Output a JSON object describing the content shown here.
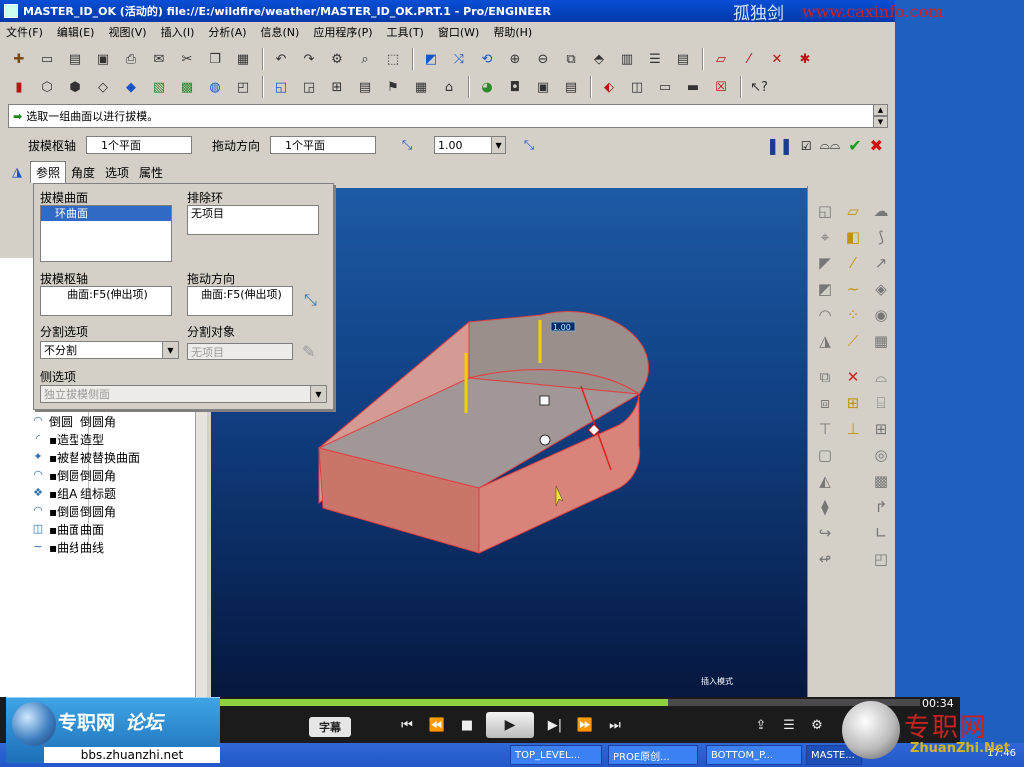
{
  "window": {
    "title": "MASTER_ID_OK (活动的) file://E:/wildfire/weather/MASTER_ID_OK.PRT.1 - Pro/ENGINEER",
    "watermark_name": "孤独剑",
    "watermark_url": "www.caxinfo.com"
  },
  "menu": [
    "文件(F)",
    "编辑(E)",
    "视图(V)",
    "插入(I)",
    "分析(A)",
    "信息(N)",
    "应用程序(P)",
    "工具(T)",
    "窗口(W)",
    "帮助(H)"
  ],
  "message": "选取一组曲面以进行拔模。",
  "dashboard": {
    "axis_label": "拔模枢轴",
    "axis_value": "1个平面",
    "direction_label": "拖动方向",
    "direction_value": "1个平面",
    "angle_value": "1.00"
  },
  "tabs": [
    "参照",
    "角度",
    "选项",
    "属性"
  ],
  "refs_panel": {
    "draft_surfaces_label": "拔模曲面",
    "draft_surfaces_value": "环曲面",
    "exclude_loops_label": "排除环",
    "exclude_loops_value": "无项目",
    "pivot_label": "拔模枢轴",
    "pivot_value": "曲面:F5(伸出项)",
    "drag_dir_label": "拖动方向",
    "drag_dir_value": "曲面:F5(伸出项)",
    "split_option_label": "分割选项",
    "split_option_value": "不分割",
    "split_object_label": "分割对象",
    "split_object_value": "无项目",
    "side_option_label": "侧选项",
    "side_option_value": "独立拔模侧面"
  },
  "tree": [
    {
      "icon": "round-icon",
      "glyph": "◠",
      "name": "倒圆",
      "type": "倒圆角"
    },
    {
      "icon": "style-icon",
      "glyph": "◜",
      "name": "▪造型",
      "type": "造型"
    },
    {
      "icon": "replace-surface-icon",
      "glyph": "✦",
      "name": "▪被替",
      "type": "被替换曲面"
    },
    {
      "icon": "round-icon",
      "glyph": "◠",
      "name": "▪倒圆",
      "type": "倒圆角"
    },
    {
      "icon": "group-icon",
      "glyph": "❖",
      "name": "▪组AU",
      "type": "组标题"
    },
    {
      "icon": "round-icon",
      "glyph": "◠",
      "name": "▪倒圆",
      "type": "倒圆角"
    },
    {
      "icon": "surface-icon",
      "glyph": "◫",
      "name": "▪曲面",
      "type": "曲面"
    },
    {
      "icon": "curve-icon",
      "glyph": "∼",
      "name": "▪曲线",
      "type": "曲线"
    }
  ],
  "viewport": {
    "mode_text": "插入模式",
    "dimension_text": "1.00"
  },
  "player": {
    "time": "00:34",
    "subtitle_btn": "字幕",
    "progress": 0.64
  },
  "taskbar": {
    "items": [
      "TOP_LEVEL...",
      "PROE原创...",
      "BOTTOM_P...",
      "MASTE..."
    ],
    "clock": "17:46"
  },
  "logos": {
    "left_title": "专职网",
    "left_script": "论坛",
    "left_url": "bbs.zhuanzhi.net",
    "right_title": "专职网",
    "right_site": "ZhuanZhi.Net"
  }
}
